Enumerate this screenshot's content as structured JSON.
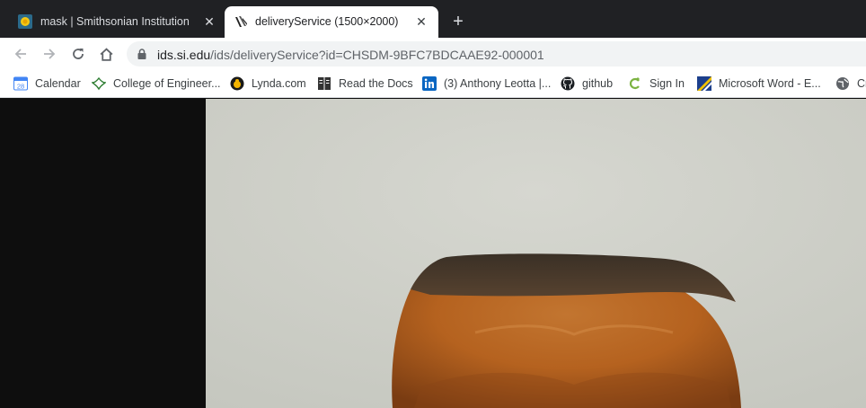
{
  "tabs": [
    {
      "title": "mask | Smithsonian Institution",
      "active": false
    },
    {
      "title": "deliveryService (1500×2000)",
      "active": true
    }
  ],
  "toolbar": {
    "url_domain": "ids.si.edu",
    "url_rest": "/ids/deliveryService?id=CHSDM-9BFC7BDCAAE92-000001"
  },
  "bookmarks": [
    {
      "label": "Calendar",
      "icon": "calendar-icon"
    },
    {
      "label": "College of Engineer...",
      "icon": "college-icon"
    },
    {
      "label": "Lynda.com",
      "icon": "lynda-icon"
    },
    {
      "label": "Read the Docs",
      "icon": "readthedocs-icon"
    },
    {
      "label": "(3) Anthony Leotta |...",
      "icon": "linkedin-icon"
    },
    {
      "label": "github",
      "icon": "github-icon"
    },
    {
      "label": "Sign In",
      "icon": "signin-icon"
    },
    {
      "label": "Microsoft Word - E...",
      "icon": "word-doc-icon"
    },
    {
      "label": "Cr",
      "icon": "globe-icon"
    }
  ],
  "colors": {
    "tabstrip": "#202124",
    "background": "#0e0e0e",
    "image_wall": "#cfd0c9",
    "mask": "#b5621f"
  }
}
